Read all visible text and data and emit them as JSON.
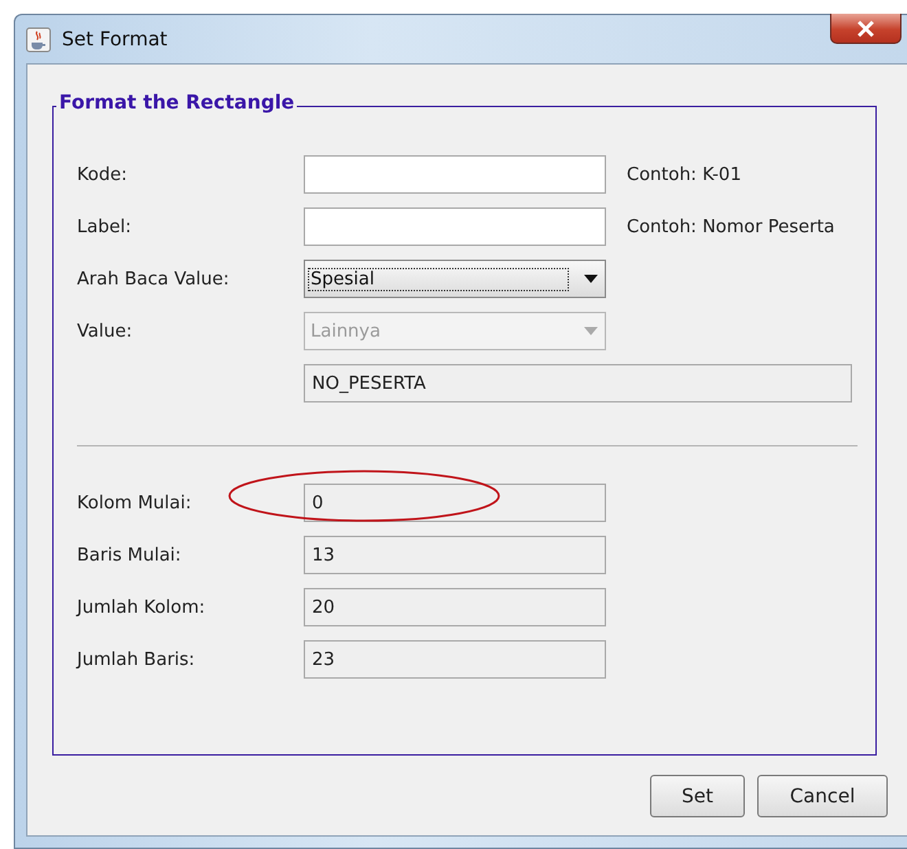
{
  "window": {
    "title": "Set Format"
  },
  "group": {
    "title": "Format the Rectangle"
  },
  "top_rows": [
    {
      "label": "Kode:",
      "kind": "text",
      "value": "",
      "disabled": false,
      "hint": "Contoh: K-01"
    },
    {
      "label": "Label:",
      "kind": "text",
      "value": "",
      "disabled": false,
      "hint": "Contoh: Nomor Peserta"
    },
    {
      "label": "Arah Baca Value:",
      "kind": "combo",
      "value": "Spesial",
      "disabled": false,
      "focused": true
    },
    {
      "label": "Value:",
      "kind": "combo",
      "value": "Lainnya",
      "disabled": true,
      "focused": false
    },
    {
      "kind": "wide",
      "value": "NO_PESERTA",
      "disabled": true
    }
  ],
  "number_rows": [
    {
      "label": "Kolom Mulai:",
      "value": "0",
      "circled": true
    },
    {
      "label": "Baris Mulai:",
      "value": "13",
      "circled": false
    },
    {
      "label": "Jumlah Kolom:",
      "value": "20",
      "circled": false
    },
    {
      "label": "Jumlah Baris:",
      "value": "23",
      "circled": false
    }
  ],
  "buttons": [
    "Set",
    "Cancel"
  ]
}
